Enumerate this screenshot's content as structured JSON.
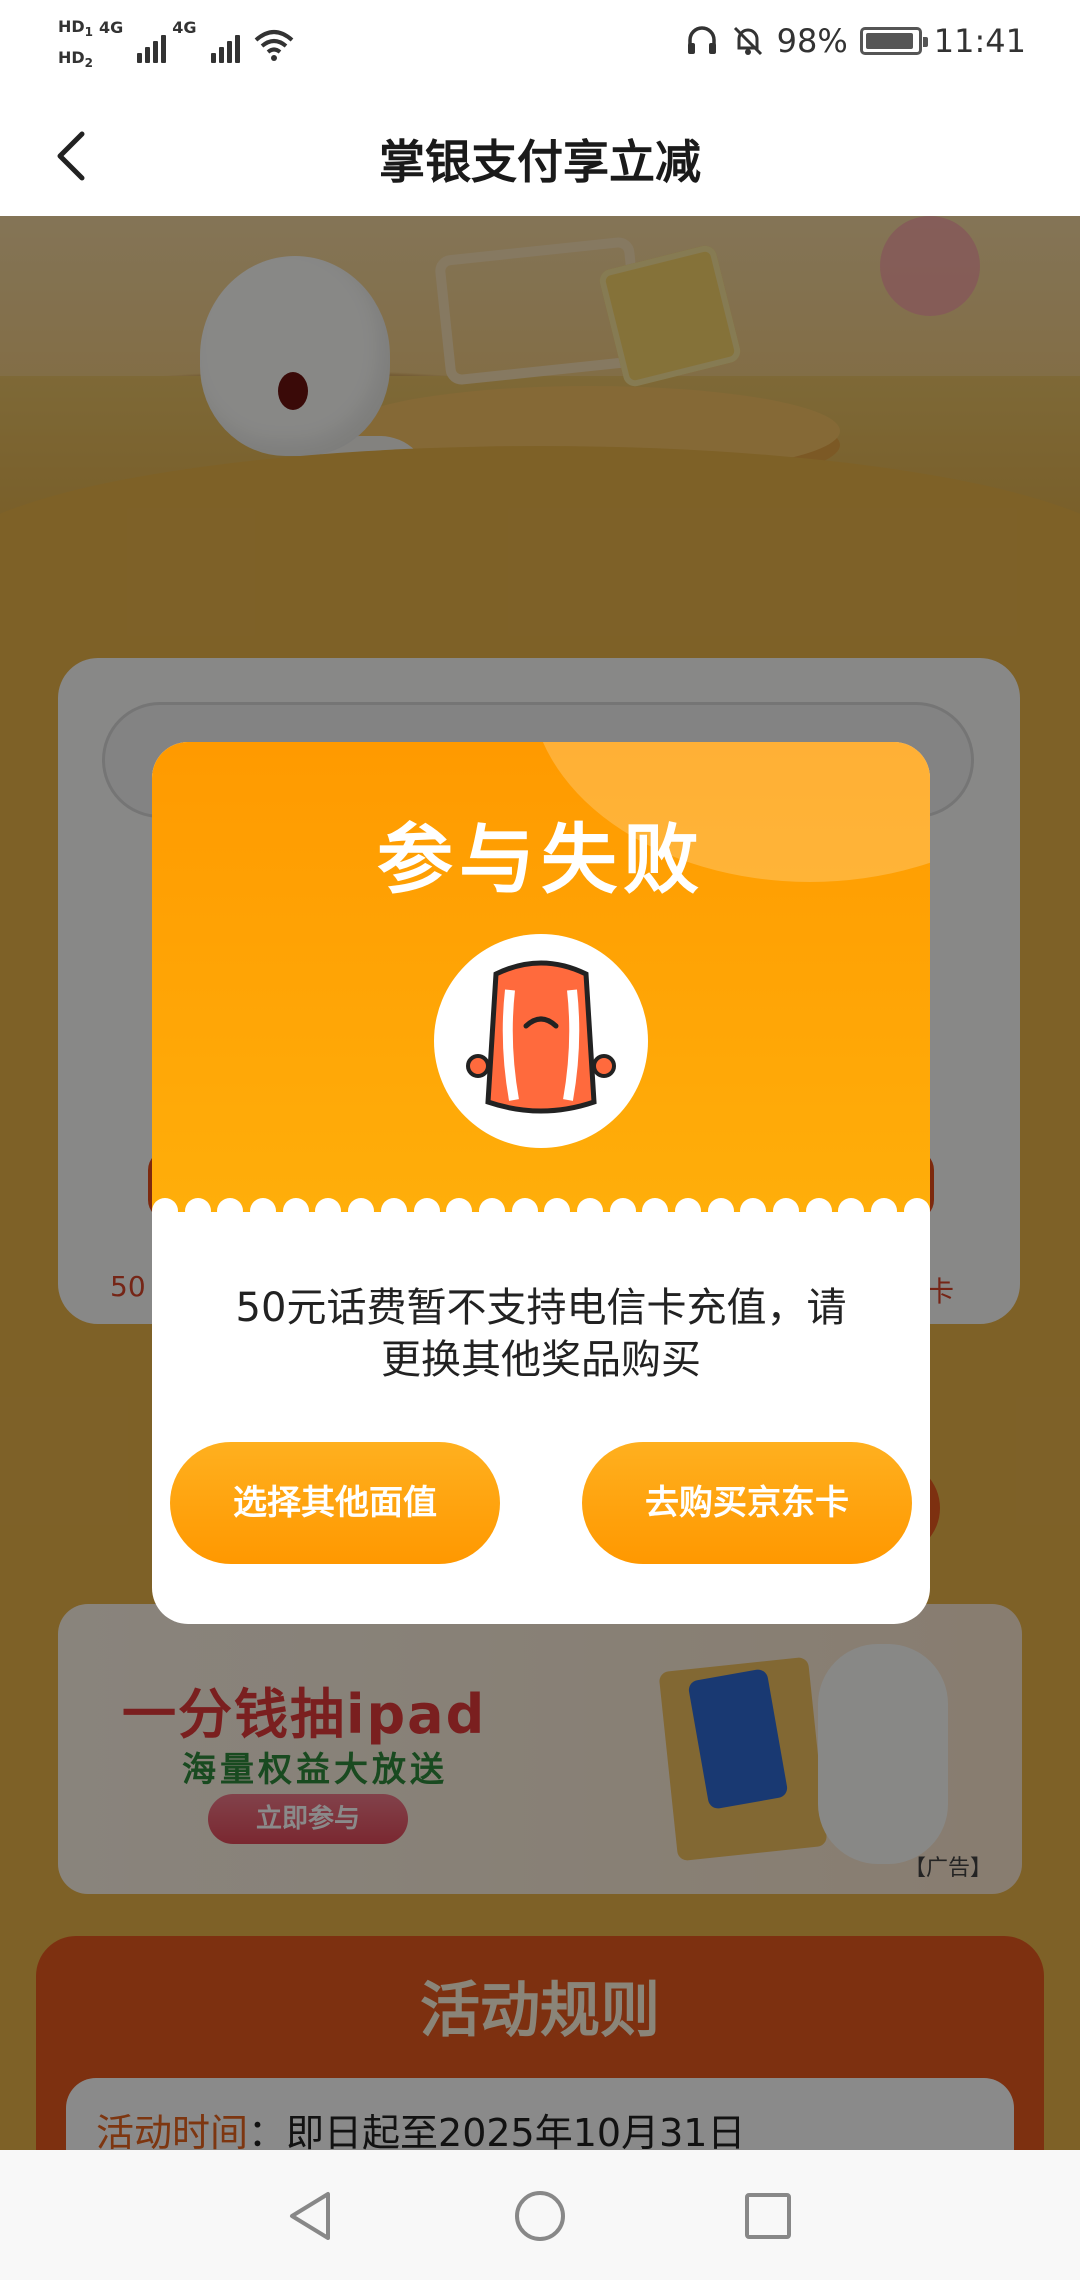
{
  "status_bar": {
    "hd1": "HD",
    "hd1_index": "1",
    "hd2": "HD",
    "hd2_index": "2",
    "net1": "4G",
    "net2": "4G",
    "battery": "98%",
    "time": "11:41"
  },
  "nav": {
    "title": "掌银支付享立减"
  },
  "background": {
    "card_text_left": "50",
    "card_text_right": "卡",
    "promo": {
      "title": "一分钱抽ipad",
      "subtitle": "海量权益大放送",
      "button": "立即参与",
      "ad_tag": "【广告】"
    },
    "rules": {
      "title": "活动规则",
      "time_label": "活动时间",
      "time_value": "：即日起至2025年10月31日"
    }
  },
  "modal": {
    "title": "参与失败",
    "message_line1": "50元话费暂不支持电信卡充值，请",
    "message_line2": "更换其他奖品购买",
    "btn_other": "选择其他面值",
    "btn_jd": "去购买京东卡"
  },
  "colors": {
    "modal_orange": "#ff9a00",
    "button_orange": "#ffa70f",
    "accent_red": "#e85a1e"
  }
}
